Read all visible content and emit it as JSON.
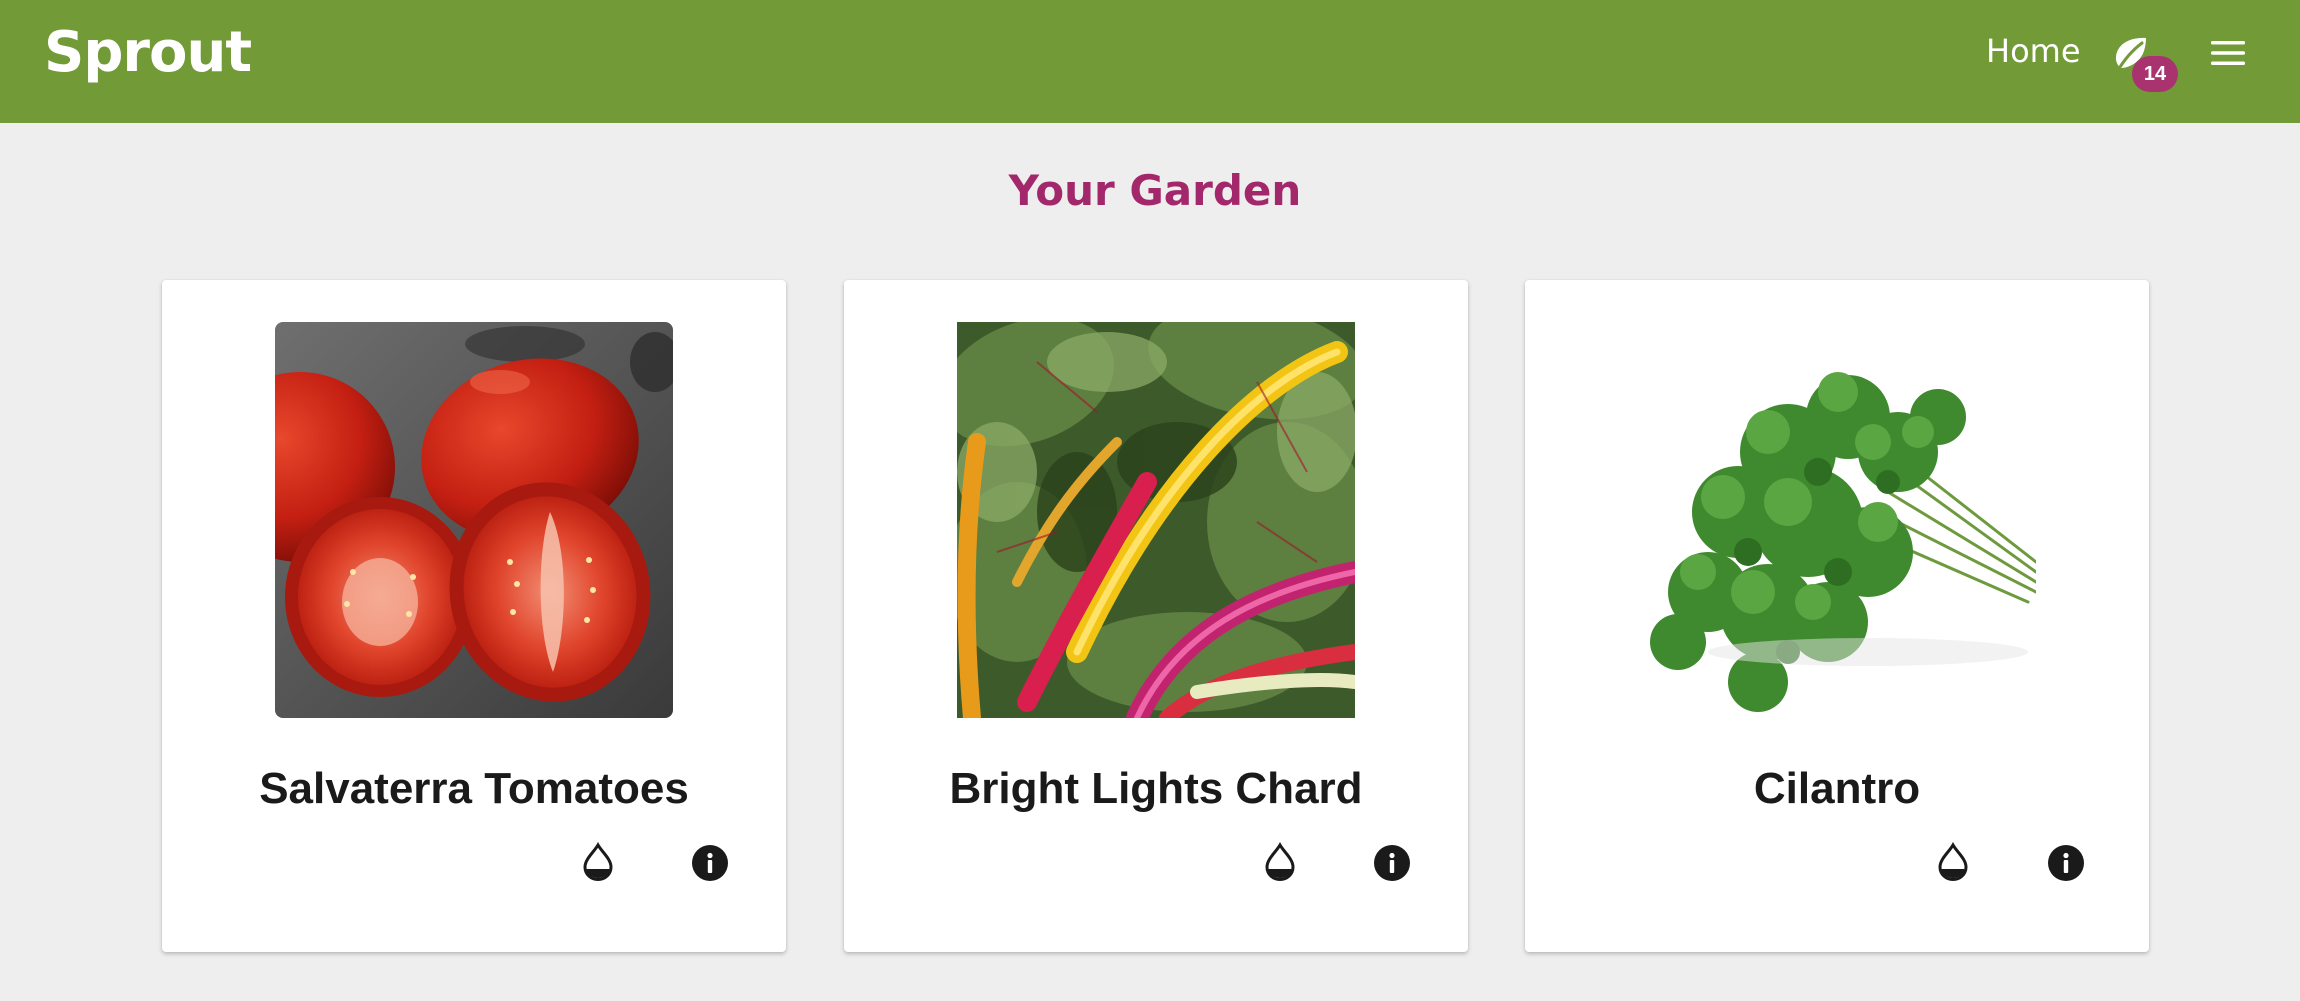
{
  "header": {
    "brand": "Sprout",
    "nav_home": "Home",
    "garden_badge_count": "14",
    "leaf_icon": "leaf-icon",
    "menu_icon": "hamburger-menu-icon",
    "background_color": "#729a37",
    "badge_color": "#a8336e"
  },
  "main": {
    "title": "Your Garden",
    "title_color": "#a3286b",
    "plants": [
      {
        "name": "Salvaterra Tomatoes",
        "image": "tomatoes-photo",
        "water_icon": "water-drop-icon",
        "info_icon": "info-icon"
      },
      {
        "name": "Bright Lights Chard",
        "image": "chard-photo",
        "water_icon": "water-drop-icon",
        "info_icon": "info-icon"
      },
      {
        "name": "Cilantro",
        "image": "cilantro-photo",
        "water_icon": "water-drop-icon",
        "info_icon": "info-icon"
      }
    ]
  }
}
